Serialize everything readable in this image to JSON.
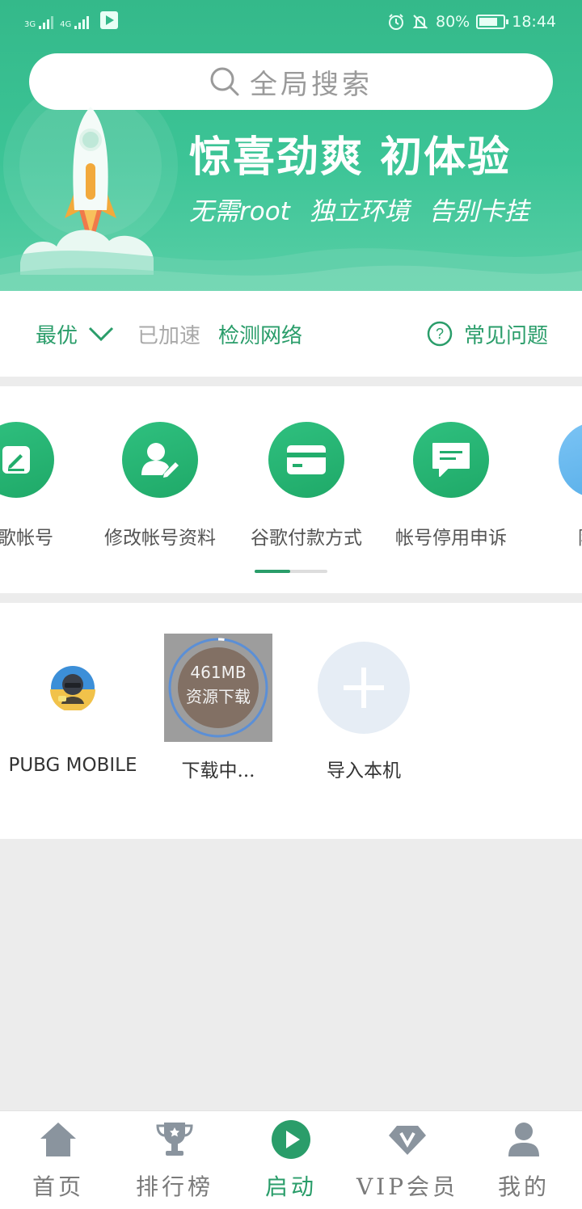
{
  "status_bar": {
    "sim1": "3G",
    "sim2": "4G",
    "battery": "80%",
    "time": "18:44"
  },
  "search": {
    "placeholder": "全局搜索"
  },
  "banner": {
    "headline": "惊喜劲爽  初体验",
    "subline": "无需root 独立环境 告别卡挂"
  },
  "network": {
    "mode": "最优",
    "status": "已加速",
    "check": "检测网络",
    "faq": "常见问题"
  },
  "tools": [
    {
      "label": "谷歌帐号",
      "icon": "edit-icon"
    },
    {
      "label": "修改帐号资料",
      "icon": "user-edit-icon"
    },
    {
      "label": "谷歌付款方式",
      "icon": "card-icon"
    },
    {
      "label": "帐号停用申诉",
      "icon": "message-icon"
    },
    {
      "label": "隐藏",
      "icon": "hide-icon"
    }
  ],
  "apps": [
    {
      "label": "PUBG MOBILE"
    },
    {
      "label": "下载中...",
      "size": "461MB",
      "status": "资源下载",
      "progress": 0.02
    },
    {
      "label": "导入本机"
    }
  ],
  "nav": [
    {
      "label": "首页",
      "icon": "home-icon"
    },
    {
      "label": "排行榜",
      "icon": "trophy-icon"
    },
    {
      "label": "启动",
      "icon": "play-icon",
      "active": true
    },
    {
      "label": "VIP会员",
      "icon": "vip-icon"
    },
    {
      "label": "我的",
      "icon": "profile-icon"
    }
  ],
  "colors": {
    "brand": "#34b98a",
    "accent": "#2a9d6a",
    "progress": "#5b8fd6"
  }
}
